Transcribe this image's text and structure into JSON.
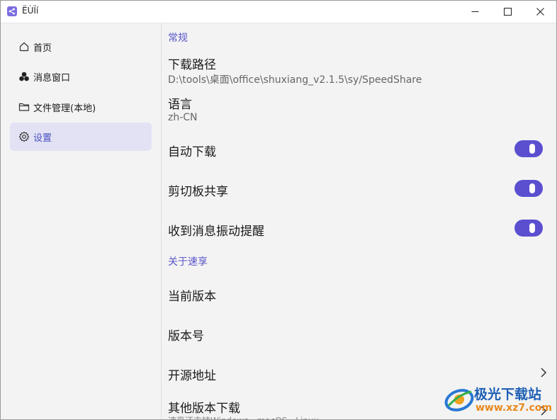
{
  "window": {
    "title": "ËÙÏí"
  },
  "sidebar": {
    "items": [
      {
        "label": "首页",
        "icon": "home-icon"
      },
      {
        "label": "消息窗口",
        "icon": "messages-icon"
      },
      {
        "label": "文件管理(本地)",
        "icon": "folder-icon"
      },
      {
        "label": "设置",
        "icon": "gear-icon",
        "active": true
      }
    ]
  },
  "settings": {
    "general_title": "常规",
    "download_path": {
      "label": "下载路径",
      "value": "D:\\tools\\桌面\\office\\shuxiang_v2.1.5\\sy/SpeedShare"
    },
    "language": {
      "label": "语言",
      "value": "zh-CN"
    },
    "auto_download": {
      "label": "自动下载",
      "enabled": true
    },
    "clipboard_share": {
      "label": "剪切板共享",
      "enabled": true
    },
    "vibrate_on_message": {
      "label": "收到消息振动提醒",
      "enabled": true
    },
    "about_title": "关于速享",
    "current_version": {
      "label": "当前版本"
    },
    "version_number": {
      "label": "版本号"
    },
    "open_source": {
      "label": "开源地址"
    },
    "other_downloads": {
      "label": "其他版本下载",
      "sub": "速享还支持Windows、macOS、Linux"
    }
  },
  "watermark": {
    "title": "极光下载站",
    "url": "www.xz7.com"
  },
  "colors": {
    "accent": "#5b4fd0",
    "section": "#5a57c8",
    "active_bg": "#e3e2f5"
  }
}
